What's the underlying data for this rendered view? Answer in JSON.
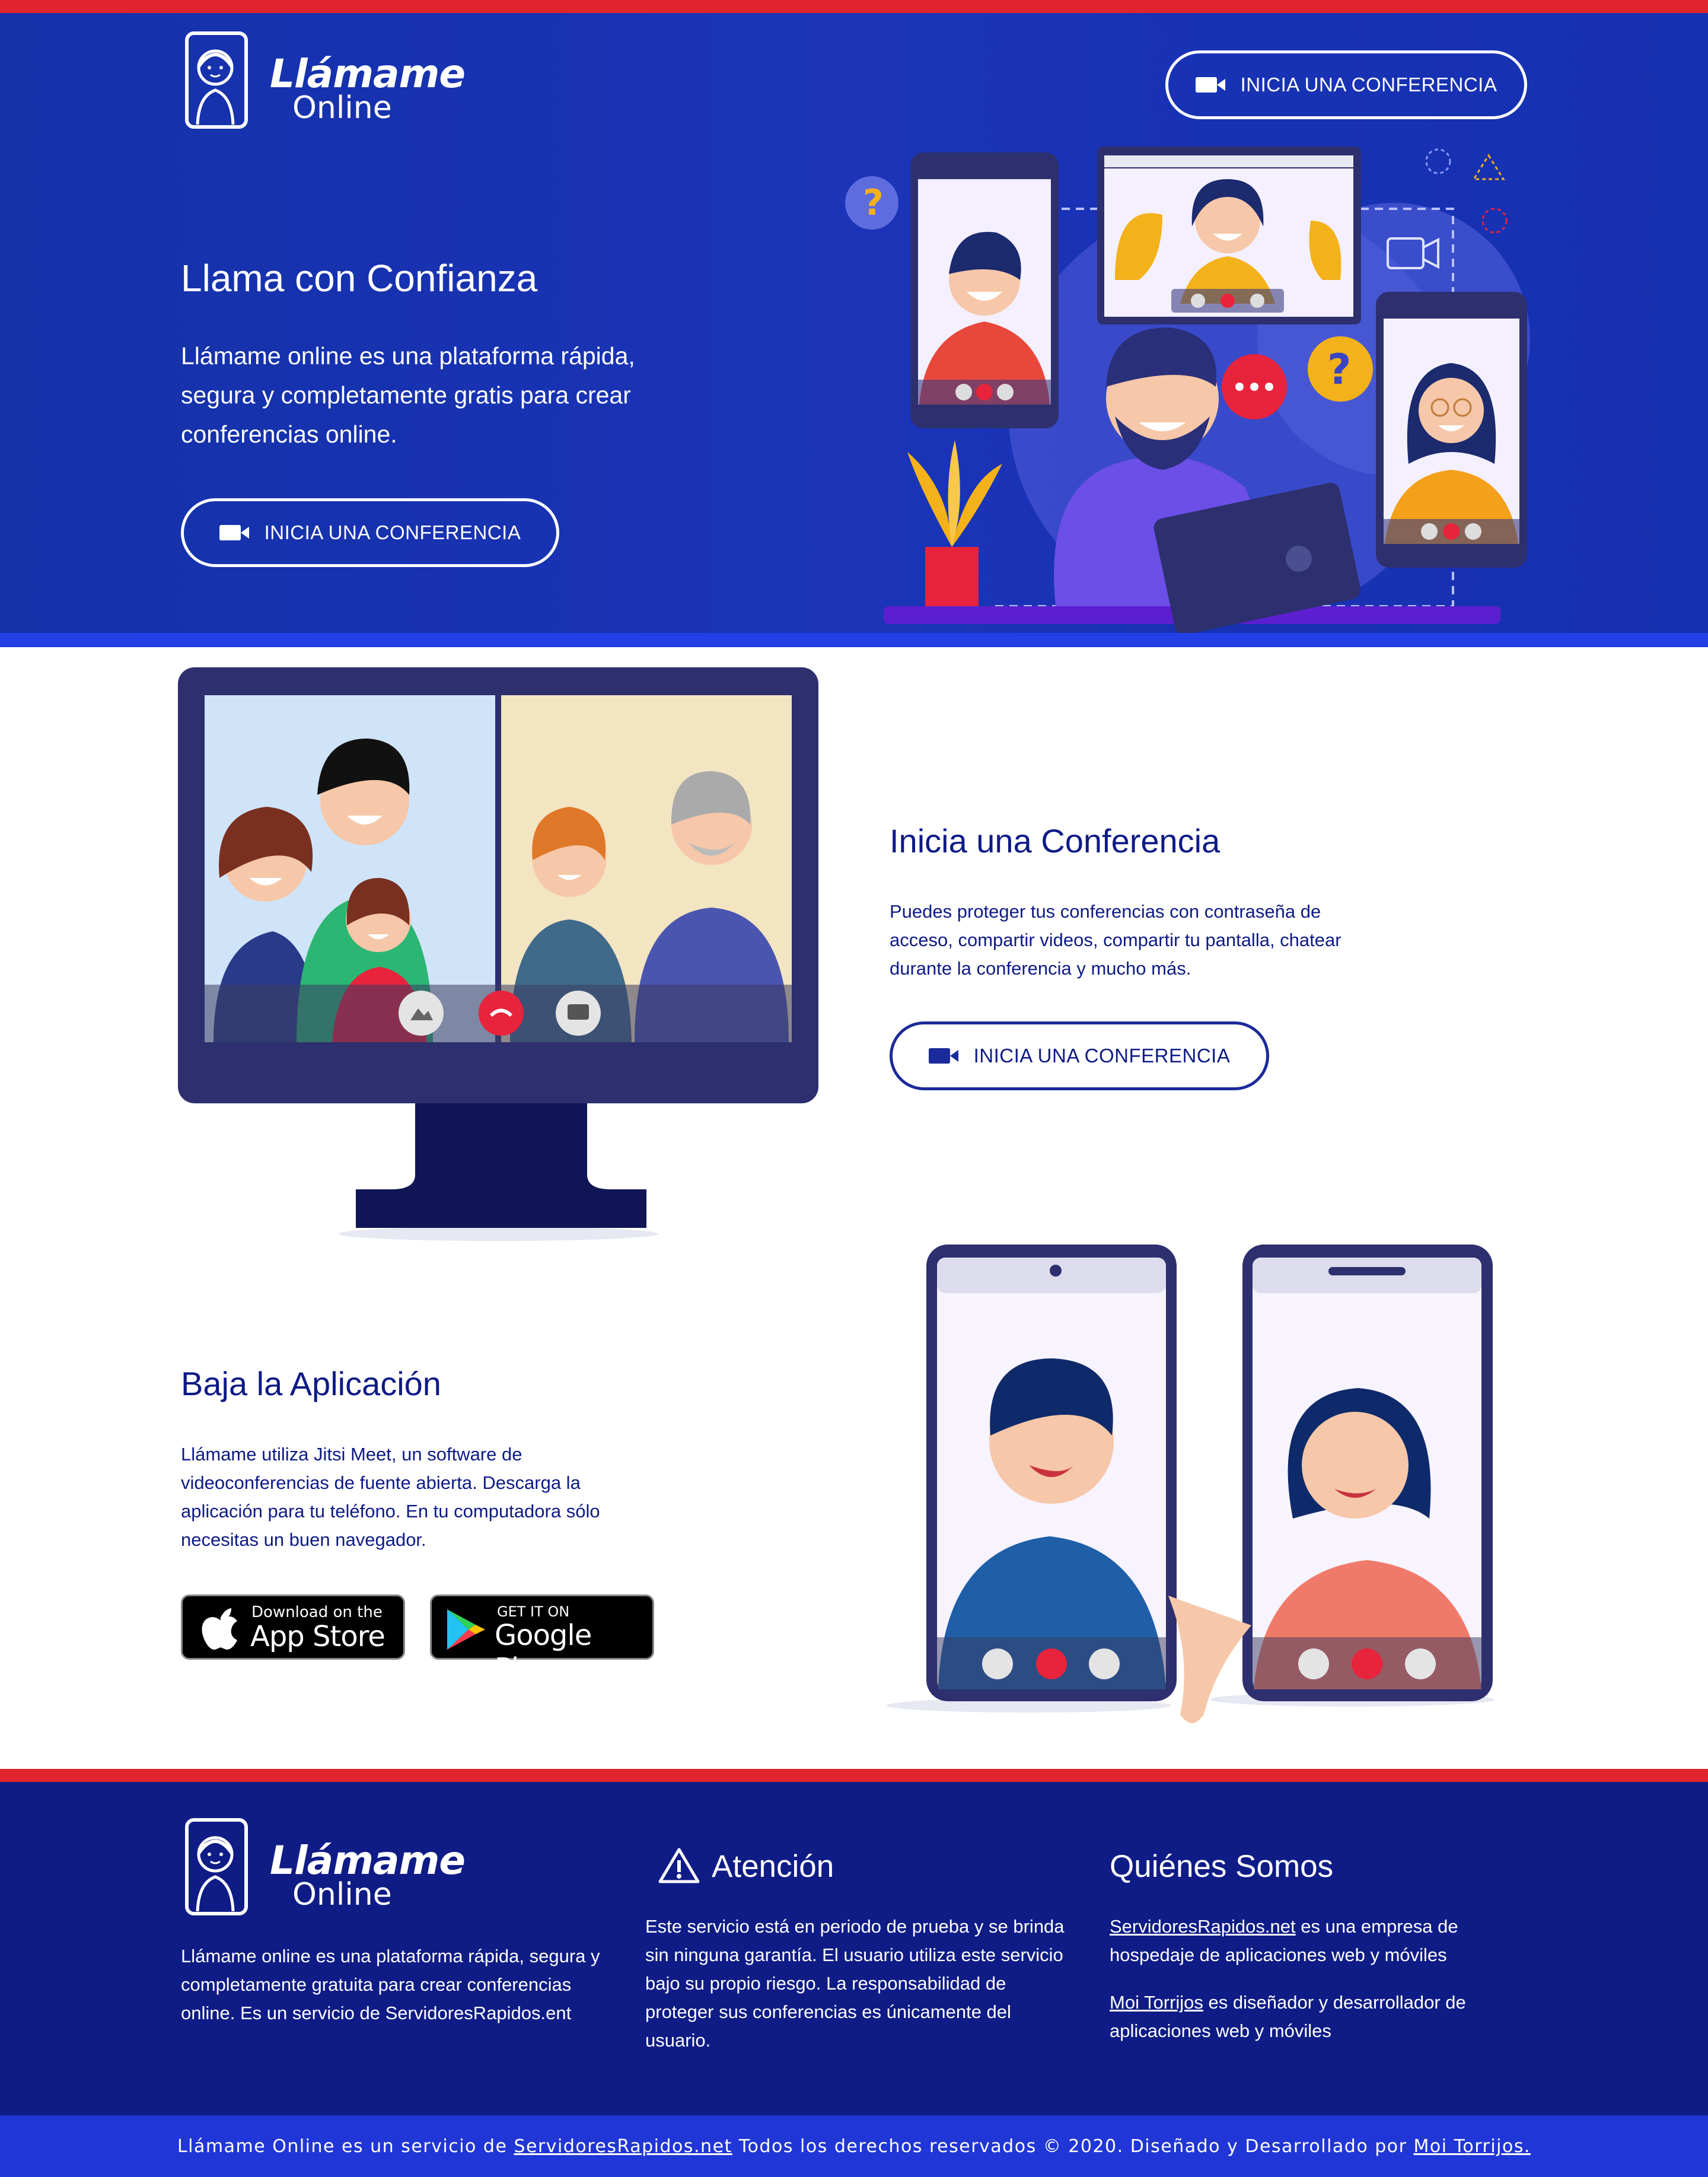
{
  "brand": {
    "name_line1": "Llámame",
    "name_line2": "Online"
  },
  "header": {
    "cta_label": "INICIA UNA CONFERENCIA"
  },
  "hero": {
    "title": "Llama con Confianza",
    "text": "Llámame online es una plataforma rápida, segura y completamente gratis para crear conferencias online.",
    "cta_label": "INICIA UNA CONFERENCIA"
  },
  "conference": {
    "title": "Inicia una Conferencia",
    "text": "Puedes proteger tus conferencias con contraseña de acceso, compartir videos, compartir tu pantalla, chatear durante la conferencia y mucho más.",
    "cta_label": "INICIA UNA CONFERENCIA"
  },
  "app": {
    "title": "Baja la Aplicación",
    "text": "Llámame utiliza Jitsi Meet, un software de videoconferencias de fuente abierta. Descarga la aplicación para tu teléfono. En tu computadora sólo necesitas un buen navegador.",
    "appstore_small": "Download on the",
    "appstore_big": "App Store",
    "googleplay_small": "GET IT ON",
    "googleplay_big": "Google Play"
  },
  "footer": {
    "about_text": "Llámame online es una plataforma rápida, segura y completamente gratuita para crear conferencias online. Es un servicio de ServidoresRapidos.ent",
    "attention_title": "Atención",
    "attention_text": "Este servicio está en periodo de prueba y se brinda sin ninguna garantía. El usuario utiliza este servicio bajo su propio riesgo. La responsabilidad de proteger sus conferencias es únicamente del usuario.",
    "who_title": "Quiénes Somos",
    "who_link1": "ServidoresRapidos.net",
    "who_text1": " es una empresa de hospedaje de aplicaciones web y móviles",
    "who_link2": "Moi Torrijos",
    "who_text2": " es diseñador y desarrollador de aplicaciones web y móviles"
  },
  "bottom": {
    "prefix": "Llámame Online es un servicio de ",
    "link1": "ServidoresRapidos.net",
    "middle": " Todos los derechos reservados © 2020. Diseñado y Desarrollado por ",
    "link2": "Moi Torrijos."
  }
}
